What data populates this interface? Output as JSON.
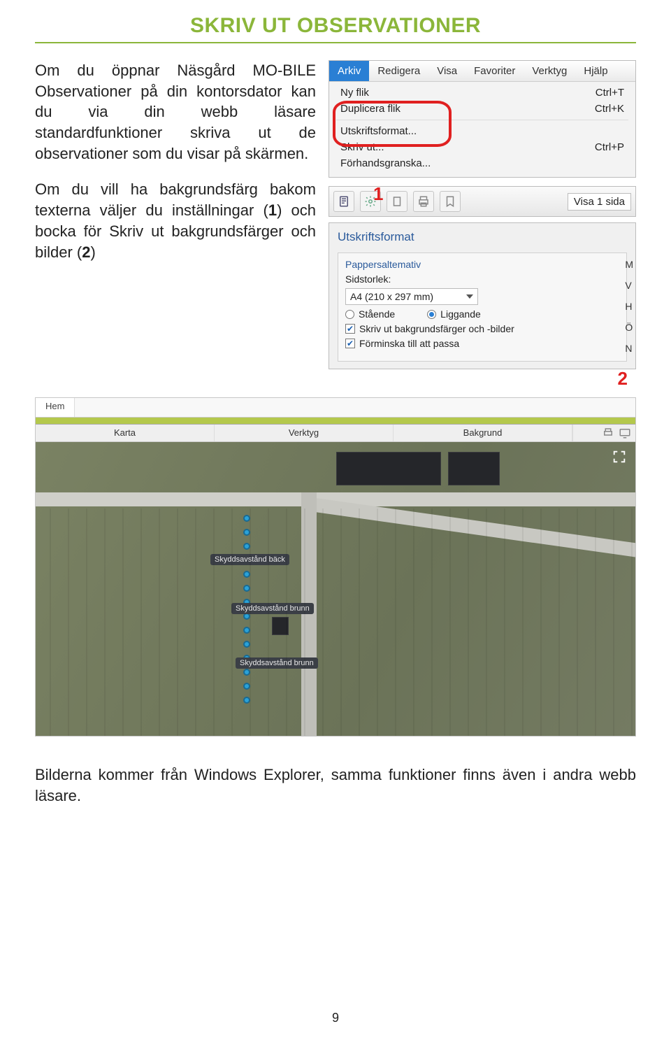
{
  "page_title": "SKRIV UT OBSERVATIONER",
  "para1": "Om du öppnar Näsgård MO-BILE Observationer på din kontorsdator kan du via din webb läsare standardfunktioner skriva ut de observationer som du visar på skärmen.",
  "para2_a": "Om du vill ha bakgrundsfärg bakom texterna väljer du inställningar (",
  "para2_b": ") och bocka för Skriv ut bakgrundsfärger och bilder (",
  "para2_c": ")",
  "n1": "1",
  "n2": "2",
  "menubar": {
    "arkiv": "Arkiv",
    "redigera": "Redigera",
    "visa": "Visa",
    "favoriter": "Favoriter",
    "verktyg": "Verktyg",
    "hjalp": "Hjälp"
  },
  "menu": {
    "ny_flik": "Ny flik",
    "ny_flik_key": "Ctrl+T",
    "dup": "Duplicera flik",
    "dup_key": "Ctrl+K",
    "utskrift": "Utskriftsformat...",
    "skriv_ut": "Skriv ut...",
    "skriv_ut_key": "Ctrl+P",
    "forhand": "Förhandsgranska..."
  },
  "toolbar": {
    "zoom_text": "Visa 1 sida"
  },
  "dialog": {
    "title": "Utskriftsformat",
    "paper_legend": "Pappersaltemativ",
    "size_label": "Sidstorlek:",
    "size_value": "A4 (210 x 297 mm)",
    "portrait": "Stående",
    "landscape": "Liggande",
    "print_bg": "Skriv ut bakgrundsfärger och -bilder",
    "shrink": "Förminska till att passa",
    "side_m": "M",
    "side_v": "V",
    "side_h": "H",
    "side_o": "Ö",
    "side_n": "N"
  },
  "map": {
    "hem": "Hem",
    "karta": "Karta",
    "verktyg": "Verktyg",
    "bakgrund": "Bakgrund",
    "label1": "Skyddsavstånd bäck",
    "label2": "Skyddsavstånd brunn",
    "label3": "Skyddsavstånd brunn"
  },
  "bottom_text": "Bilderna kommer från Windows Explorer, samma funktioner finns även i andra webb läsare.",
  "page_number": "9",
  "annot_1": "1",
  "annot_2": "2"
}
